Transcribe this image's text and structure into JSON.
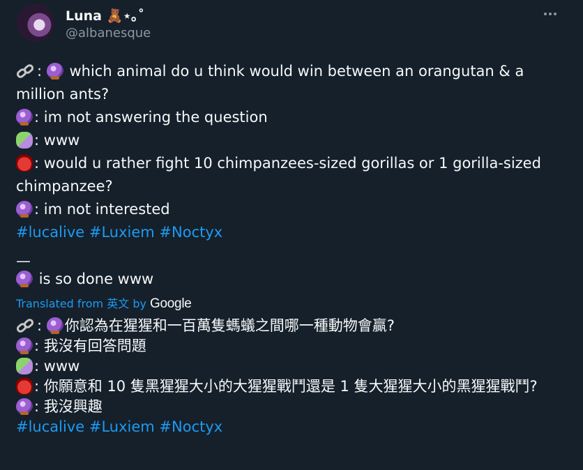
{
  "author": {
    "name": "Luna 🧸⋆｡˚",
    "handle": "@albanesque"
  },
  "menu": {
    "more_icon": "more-horizontal-icon"
  },
  "tweet": {
    "lines": [
      {
        "icons": [
          "link-icon",
          "crystal-ball-icon"
        ],
        "prefix": ":",
        "text": "which animal do u think would win between an orangutan & a million ants?"
      },
      {
        "icons": [
          "crystal-ball-icon"
        ],
        "prefix": ":",
        "text": "im not answering the question"
      },
      {
        "icons": [
          "performing-arts-icon"
        ],
        "prefix": ":",
        "text": "www"
      },
      {
        "icons": [
          "ogre-icon"
        ],
        "prefix": ":",
        "text": "would u rather fight 10 chimpanzees-sized gorillas or 1 gorilla-sized chimpanzee?"
      },
      {
        "icons": [
          "crystal-ball-icon"
        ],
        "prefix": ":",
        "text": "im not interested"
      }
    ],
    "hashtags": [
      "#lucalive",
      "#Luxiem",
      "#Noctyx"
    ],
    "separator": "—",
    "done_text": "is so done www"
  },
  "translation": {
    "label_prefix": "Translated from",
    "language": "英文",
    "by": "by",
    "provider": "Google",
    "lines": [
      {
        "text": "你認為在猩猩和一百萬隻螞蟻之間哪一種動物會贏?"
      },
      {
        "text": "我沒有回答問題"
      },
      {
        "text": "www"
      },
      {
        "text": "你願意和 10 隻黑猩猩大小的大猩猩戰鬥還是 1 隻大猩猩大小的黑猩猩戰鬥?"
      },
      {
        "text": "我沒興趣"
      }
    ],
    "hashtags": [
      "#lucalive",
      "#Luxiem",
      "#Noctyx"
    ]
  }
}
